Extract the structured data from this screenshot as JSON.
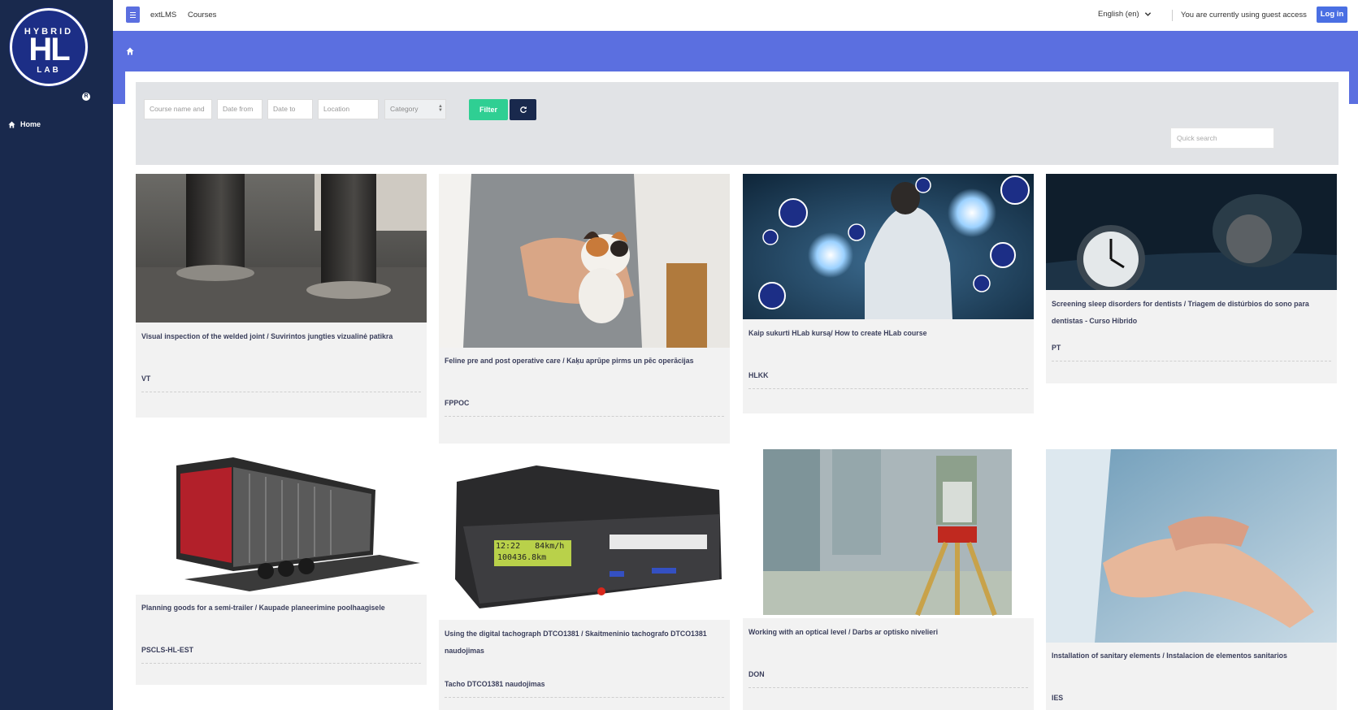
{
  "nav": {
    "links": [
      "extLMS",
      "Courses"
    ],
    "language": "English (en)",
    "guest_text": "You are currently using guest access",
    "login_label": "Log in"
  },
  "logo": {
    "top": "HYBRID",
    "main": "HL",
    "bottom": "LAB",
    "reg": "R"
  },
  "sidebar": {
    "home_label": "Home"
  },
  "filters": {
    "course_name_placeholder": "Course name and",
    "date_from_placeholder": "Date from",
    "date_to_placeholder": "Date to",
    "location_placeholder": "Location",
    "category_selected": "Category",
    "filter_label": "Filter",
    "quick_search_placeholder": "Quick search"
  },
  "courses": [
    {
      "title": "Visual inspection of the welded joint / Suvirintos jungties vizualinė patikra",
      "code": "VT"
    },
    {
      "title": "Feline pre and post operative care / Kaķu aprūpe pirms un pēc operācijas",
      "code": "FPPOC"
    },
    {
      "title": "Kaip sukurti HLab kursą/ How to create HLab course",
      "code": "HLKK"
    },
    {
      "title": "Screening sleep disorders for dentists / Triagem de distúrbios do sono para dentistas - Curso Híbrido",
      "code": "PT"
    },
    {
      "title": "Planning goods for a semi-trailer / Kaupade planeerimine poolhaagisele",
      "code": "PSCLS-HL-EST"
    },
    {
      "title": "Using the digital tachograph DTCO1381 / Skaitmeninio tachografo DTCO1381 naudojimas",
      "code": "Tacho DTCO1381 naudojimas"
    },
    {
      "title": "Working with an optical level / Darbs ar optisko nivelieri",
      "code": "DON"
    },
    {
      "title": "Installation of sanitary elements / Instalacion de elementos sanitarios",
      "code": "IES"
    }
  ],
  "tacho_display": {
    "line1": "12:22   84km/h",
    "line2": "100436.8km"
  },
  "colors": {
    "sidebar": "#19294d",
    "accent": "#5b6fe0",
    "filter_button": "#2fcf93",
    "login_button": "#4a6fe3"
  },
  "icons": [
    "menu-icon",
    "home-icon",
    "chevron-down-icon",
    "refresh-icon"
  ]
}
